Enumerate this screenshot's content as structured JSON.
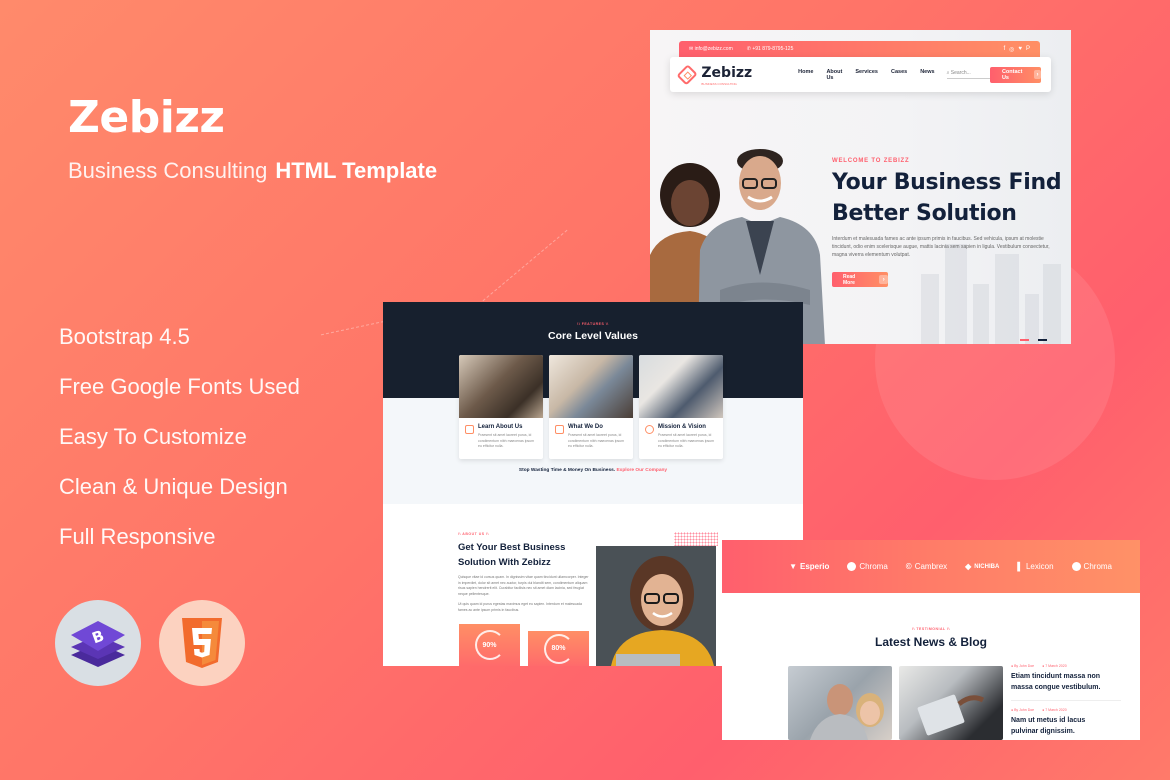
{
  "promo": {
    "title": "Zebizz",
    "subtitle_light": "Business Consulting",
    "subtitle_bold": "HTML Template",
    "features": [
      "Bootstrap 4.5",
      "Free Google Fonts Used",
      "Easy To Customize",
      "Clean & Unique Design",
      "Full Responsive"
    ],
    "badges": [
      {
        "name": "bootstrap",
        "icon": "bootstrap-logo-icon",
        "label": "B"
      },
      {
        "name": "html5",
        "icon": "html5-logo-icon",
        "label": "5"
      }
    ]
  },
  "hero_preview": {
    "topbar": {
      "email": "info@zebizz.com",
      "phone": "+91 879-8795-125",
      "social": [
        "f",
        "◎",
        "♥",
        "P"
      ]
    },
    "navbar": {
      "logo": "Zebizz",
      "logo_tagline": "BUSINESS CONSULTING",
      "links": [
        "Home",
        "About Us",
        "Services",
        "Cases",
        "News"
      ],
      "search_placeholder": "Search...",
      "cta": "Contact Us"
    },
    "eyebrow": "WELCOME TO ZEBIZZ",
    "title_line1": "Your Business Find",
    "title_line2": "Better Solution",
    "description": "Interdum et malesuada fames ac ante ipsum primis in faucibus. Sed vehicula, ipsum at molestie tincidunt, odio enim scelerisque augue, mattis lacinia sem sapien in ligula. Vestibulum consectetur, magna viverra elementum volutpat.",
    "button": "Read More"
  },
  "values_preview": {
    "eyebrow": "\\\\ FEATURES \\\\",
    "title": "Core Level Values",
    "cards": [
      {
        "title": "Learn About Us",
        "text": "Praesent sit amet laoreet purus, id condimentum nibh maecenas ipsum eu efficitur nulla."
      },
      {
        "title": "What We Do",
        "text": "Praesent sit amet laoreet purus, id condimentum nibh maecenas ipsum eu efficitur nulla."
      },
      {
        "title": "Mission & Vision",
        "text": "Praesent sit amet laoreet purus, id condimentum nibh maecenas ipsum eu efficitur nulla."
      }
    ],
    "cta_text": "Stop Wasting Time & Money On Business.",
    "cta_link": "Explore Our Company",
    "about": {
      "eyebrow": "\\\\ ABOUT US \\\\",
      "title_line1": "Get Your Best Business",
      "title_line2": "Solution With Zebizz",
      "paragraph1": "Quisque vitae id cursus quam. In dignissim vitae quam tincidunt ullamcorper. Integer in imperdiet, dolor sit amet nec auctor, turpis dui blandit sem, condimentum aliquam risus sapien hendrerit elit. Curabitur facilisis nec sit amet diam lacinia, sed feugiat neque pellentesque.",
      "paragraph2": "Ut quis quam id purus egestas maximus eget eu sapien. Interdum et malesuada fames ac ante ipsum primis in faucibus."
    },
    "stats": [
      {
        "label": "90%",
        "value": 90
      },
      {
        "label": "80%",
        "value": 80
      }
    ]
  },
  "blog_preview": {
    "clients": [
      "Esperio",
      "Chroma",
      "Cambrex",
      "NICHIBA",
      "Lexicon",
      "Chroma"
    ],
    "eyebrow": "\\\\ TESTIMONIAL \\\\",
    "title": "Latest News & Blog",
    "posts": [
      {
        "author": "By John Doe",
        "date": "7 March 2020",
        "title_line1": "Etiam tincidunt massa non",
        "title_line2": "massa congue vestibulum."
      },
      {
        "author": "By John Doe",
        "date": "7 March 2020",
        "title_line1": "Nam ut metus id lacus",
        "title_line2": "pulvinar dignissim."
      }
    ]
  },
  "colors": {
    "accent": "#ff5f6d",
    "accent_secondary": "#ff8f65",
    "navy": "#13213b",
    "dark_section": "#17202e"
  }
}
